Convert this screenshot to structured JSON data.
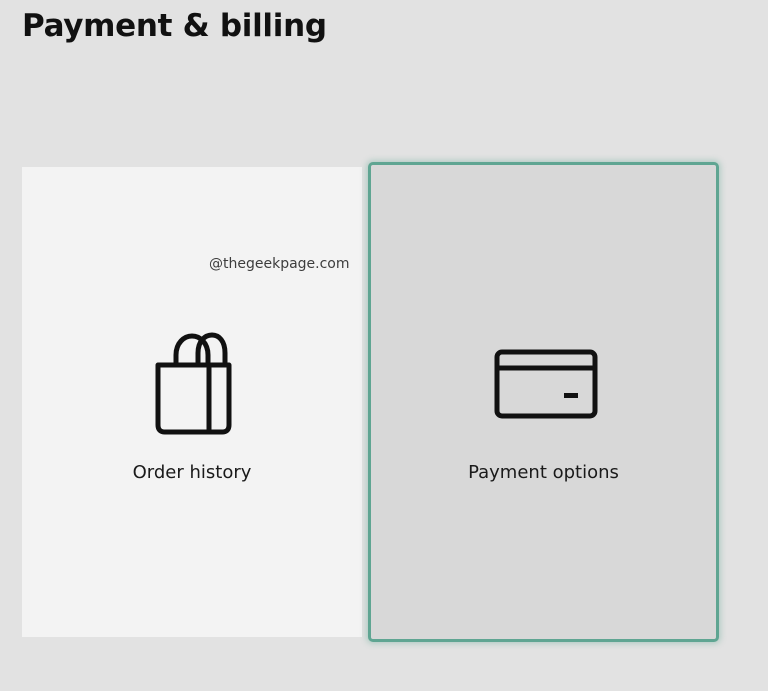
{
  "page": {
    "title": "Payment & billing"
  },
  "tiles": [
    {
      "label": "Order history",
      "icon": "shopping-bag-icon",
      "selected": false
    },
    {
      "label": "Payment options",
      "icon": "credit-card-icon",
      "selected": true
    }
  ],
  "watermark": "@thegeekpage.com",
  "colors": {
    "background": "#e2e2e2",
    "tile_default": "#f3f3f3",
    "tile_selected": "#d8d8d8",
    "focus_accent": "#5fa592",
    "text": "#111111"
  }
}
